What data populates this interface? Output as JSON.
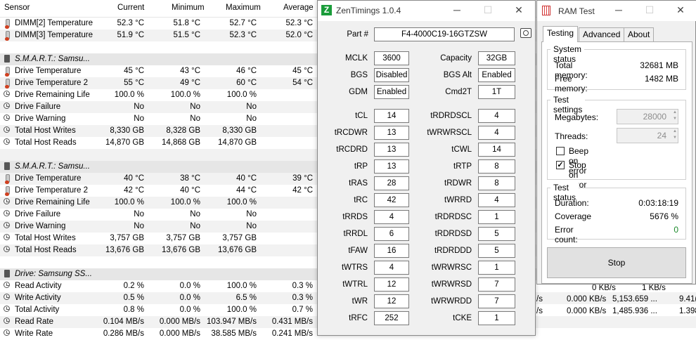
{
  "hwinfo": {
    "headers": [
      "Sensor",
      "Current",
      "Minimum",
      "Maximum",
      "Average"
    ],
    "rows": [
      {
        "type": "sensor",
        "icon": "thermometer-icon",
        "name": "DIMM[2] Temperature",
        "cur": "52.3 °C",
        "min": "51.8 °C",
        "max": "52.7 °C",
        "avg": "52.3 °C"
      },
      {
        "type": "sensor",
        "icon": "thermometer-icon",
        "name": "DIMM[3] Temperature",
        "cur": "51.9 °C",
        "min": "51.5 °C",
        "max": "52.3 °C",
        "avg": "52.0 °C"
      },
      {
        "type": "blank"
      },
      {
        "type": "group",
        "icon": "disk-icon",
        "name": "S.M.A.R.T.: Samsu..."
      },
      {
        "type": "sensor",
        "icon": "thermometer-icon",
        "name": "Drive Temperature",
        "cur": "45 °C",
        "min": "43 °C",
        "max": "46 °C",
        "avg": "45 °C"
      },
      {
        "type": "sensor",
        "icon": "thermometer-icon",
        "name": "Drive Temperature 2",
        "cur": "55 °C",
        "min": "49 °C",
        "max": "60 °C",
        "avg": "54 °C"
      },
      {
        "type": "sensor",
        "icon": "clock-icon",
        "name": "Drive Remaining Life",
        "cur": "100.0 %",
        "min": "100.0 %",
        "max": "100.0 %",
        "avg": ""
      },
      {
        "type": "sensor",
        "icon": "clock-icon",
        "name": "Drive Failure",
        "cur": "No",
        "min": "No",
        "max": "No",
        "avg": ""
      },
      {
        "type": "sensor",
        "icon": "clock-icon",
        "name": "Drive Warning",
        "cur": "No",
        "min": "No",
        "max": "No",
        "avg": ""
      },
      {
        "type": "sensor",
        "icon": "clock-icon",
        "name": "Total Host Writes",
        "cur": "8,330 GB",
        "min": "8,328 GB",
        "max": "8,330 GB",
        "avg": ""
      },
      {
        "type": "sensor",
        "icon": "clock-icon",
        "name": "Total Host Reads",
        "cur": "14,870 GB",
        "min": "14,868 GB",
        "max": "14,870 GB",
        "avg": ""
      },
      {
        "type": "blank"
      },
      {
        "type": "group",
        "icon": "disk-icon",
        "name": "S.M.A.R.T.: Samsu..."
      },
      {
        "type": "sensor",
        "icon": "thermometer-icon",
        "name": "Drive Temperature",
        "cur": "40 °C",
        "min": "38 °C",
        "max": "40 °C",
        "avg": "39 °C"
      },
      {
        "type": "sensor",
        "icon": "thermometer-icon",
        "name": "Drive Temperature 2",
        "cur": "42 °C",
        "min": "40 °C",
        "max": "44 °C",
        "avg": "42 °C"
      },
      {
        "type": "sensor",
        "icon": "clock-icon",
        "name": "Drive Remaining Life",
        "cur": "100.0 %",
        "min": "100.0 %",
        "max": "100.0 %",
        "avg": ""
      },
      {
        "type": "sensor",
        "icon": "clock-icon",
        "name": "Drive Failure",
        "cur": "No",
        "min": "No",
        "max": "No",
        "avg": ""
      },
      {
        "type": "sensor",
        "icon": "clock-icon",
        "name": "Drive Warning",
        "cur": "No",
        "min": "No",
        "max": "No",
        "avg": ""
      },
      {
        "type": "sensor",
        "icon": "clock-icon",
        "name": "Total Host Writes",
        "cur": "3,757 GB",
        "min": "3,757 GB",
        "max": "3,757 GB",
        "avg": ""
      },
      {
        "type": "sensor",
        "icon": "clock-icon",
        "name": "Total Host Reads",
        "cur": "13,676 GB",
        "min": "13,676 GB",
        "max": "13,676 GB",
        "avg": ""
      },
      {
        "type": "blank"
      },
      {
        "type": "group",
        "icon": "disk-icon",
        "name": "Drive: Samsung SS..."
      },
      {
        "type": "sensor",
        "icon": "clock-icon",
        "name": "Read Activity",
        "cur": "0.2 %",
        "min": "0.0 %",
        "max": "100.0 %",
        "avg": "0.3 %"
      },
      {
        "type": "sensor",
        "icon": "clock-icon",
        "name": "Write Activity",
        "cur": "0.5 %",
        "min": "0.0 %",
        "max": "6.5 %",
        "avg": "0.3 %"
      },
      {
        "type": "sensor",
        "icon": "clock-icon",
        "name": "Total Activity",
        "cur": "0.8 %",
        "min": "0.0 %",
        "max": "100.0 %",
        "avg": "0.7 %"
      },
      {
        "type": "sensor",
        "icon": "clock-icon",
        "name": "Read Rate",
        "cur": "0.104 MB/s",
        "min": "0.000 MB/s",
        "max": "103.947 MB/s",
        "avg": "0.431 MB/s"
      },
      {
        "type": "sensor",
        "icon": "clock-icon",
        "name": "Write Rate",
        "cur": "0.286 MB/s",
        "min": "0.000 MB/s",
        "max": "38.585 MB/s",
        "avg": "0.241 MB/s"
      }
    ],
    "right_fragments": [
      {
        "text": "0 KB/s",
        "row": 0
      },
      {
        "text": "1 KB/s",
        "row": 0
      },
      {
        "text": "/s",
        "row": 1
      },
      {
        "text": "0.000 KB/s",
        "row": 1
      },
      {
        "text": "5,153.659 ...",
        "row": 1
      },
      {
        "text": "9.41(",
        "row": 1
      },
      {
        "text": "/s",
        "row": 2
      },
      {
        "text": "0.000 KB/s",
        "row": 2
      },
      {
        "text": "1,485.936 ...",
        "row": 2
      },
      {
        "text": "1.398",
        "row": 2
      }
    ]
  },
  "zentimings": {
    "title": "ZenTimings 1.0.4",
    "icon_letter": "Z",
    "part_label": "Part #",
    "part_value": "F4-4000C19-16GTZSW",
    "left": [
      {
        "label": "MCLK",
        "value": "3600"
      },
      {
        "label": "BGS",
        "value": "Disabled"
      },
      {
        "label": "GDM",
        "value": "Enabled"
      },
      {
        "label": "tCL",
        "value": "14"
      },
      {
        "label": "tRCDWR",
        "value": "13"
      },
      {
        "label": "tRCDRD",
        "value": "13"
      },
      {
        "label": "tRP",
        "value": "13"
      },
      {
        "label": "tRAS",
        "value": "28"
      },
      {
        "label": "tRC",
        "value": "42"
      },
      {
        "label": "tRRDS",
        "value": "4"
      },
      {
        "label": "tRRDL",
        "value": "6"
      },
      {
        "label": "tFAW",
        "value": "16"
      },
      {
        "label": "tWTRS",
        "value": "4"
      },
      {
        "label": "tWTRL",
        "value": "12"
      },
      {
        "label": "tWR",
        "value": "12"
      },
      {
        "label": "tRFC",
        "value": "252"
      }
    ],
    "right": [
      {
        "label": "Capacity",
        "value": "32GB"
      },
      {
        "label": "BGS Alt",
        "value": "Enabled"
      },
      {
        "label": "Cmd2T",
        "value": "1T"
      },
      {
        "label": "tRDRDSCL",
        "value": "4"
      },
      {
        "label": "tWRWRSCL",
        "value": "4"
      },
      {
        "label": "tCWL",
        "value": "14"
      },
      {
        "label": "tRTP",
        "value": "8"
      },
      {
        "label": "tRDWR",
        "value": "8"
      },
      {
        "label": "tWRRD",
        "value": "4"
      },
      {
        "label": "tRDRDSC",
        "value": "1"
      },
      {
        "label": "tRDRDSD",
        "value": "5"
      },
      {
        "label": "tRDRDDD",
        "value": "5"
      },
      {
        "label": "tWRWRSC",
        "value": "1"
      },
      {
        "label": "tWRWRSD",
        "value": "7"
      },
      {
        "label": "tWRWRDD",
        "value": "7"
      },
      {
        "label": "tCKE",
        "value": "1"
      }
    ]
  },
  "ramtest": {
    "title": "RAM Test",
    "tabs": [
      "Testing",
      "Advanced",
      "About"
    ],
    "active_tab": "Testing",
    "system_status": {
      "title": "System status",
      "total_label": "Total memory:",
      "total_value": "32681 MB",
      "free_label": "Free memory:",
      "free_value": "1482 MB"
    },
    "test_settings": {
      "title": "Test settings",
      "megabytes_label": "Megabytes:",
      "megabytes_value": "28000",
      "threads_label": "Threads:",
      "threads_value": "24",
      "beep_label": "Beep on error",
      "beep_checked": false,
      "stop_label": "Stop on error",
      "stop_checked": true
    },
    "test_status": {
      "title": "Test status",
      "duration_label": "Duration:",
      "duration_value": "0:03:18:19",
      "coverage_label": "Coverage",
      "coverage_value": "5676 %",
      "errors_label": "Error count:",
      "errors_value": "0",
      "errors_color": "#1a8a2a"
    },
    "stop_button": "Stop"
  },
  "window_controls": {
    "minimize": "─",
    "maximize": "☐",
    "close": "✕"
  }
}
